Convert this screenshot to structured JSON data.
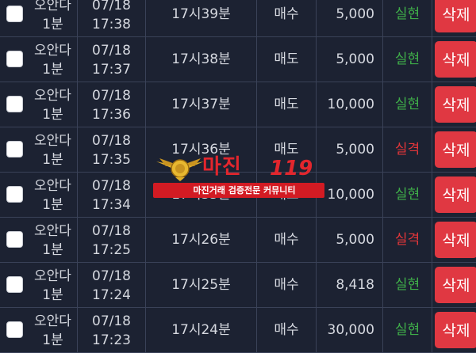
{
  "rows": [
    {
      "game_line1": "오안다",
      "game_line2": "1분",
      "date": "07/18",
      "time": "17:38",
      "round": "17시39분",
      "pick": "매수",
      "amount": "5,000",
      "result": "실현",
      "result_type": "win",
      "delete_label": "삭제"
    },
    {
      "game_line1": "오안다",
      "game_line2": "1분",
      "date": "07/18",
      "time": "17:37",
      "round": "17시38분",
      "pick": "매도",
      "amount": "5,000",
      "result": "실현",
      "result_type": "win",
      "delete_label": "삭제"
    },
    {
      "game_line1": "오안다",
      "game_line2": "1분",
      "date": "07/18",
      "time": "17:36",
      "round": "17시37분",
      "pick": "매도",
      "amount": "10,000",
      "result": "실현",
      "result_type": "win",
      "delete_label": "삭제"
    },
    {
      "game_line1": "오안다",
      "game_line2": "1분",
      "date": "07/18",
      "time": "17:35",
      "round": "17시36분",
      "pick": "매도",
      "amount": "5,000",
      "result": "실격",
      "result_type": "lose",
      "delete_label": "삭제"
    },
    {
      "game_line1": "오안다",
      "game_line2": "1분",
      "date": "07/18",
      "time": "17:34",
      "round": "17시35분",
      "pick": "매도",
      "amount": "10,000",
      "result": "실현",
      "result_type": "win",
      "delete_label": "삭제"
    },
    {
      "game_line1": "오안다",
      "game_line2": "1분",
      "date": "07/18",
      "time": "17:25",
      "round": "17시26분",
      "pick": "매수",
      "amount": "5,000",
      "result": "실격",
      "result_type": "lose",
      "delete_label": "삭제"
    },
    {
      "game_line1": "오안다",
      "game_line2": "1분",
      "date": "07/18",
      "time": "17:24",
      "round": "17시25분",
      "pick": "매수",
      "amount": "8,418",
      "result": "실현",
      "result_type": "win",
      "delete_label": "삭제"
    },
    {
      "game_line1": "오안다",
      "game_line2": "1분",
      "date": "07/18",
      "time": "17:23",
      "round": "17시24분",
      "pick": "매수",
      "amount": "30,000",
      "result": "실현",
      "result_type": "win",
      "delete_label": "삭제"
    }
  ],
  "watermark": {
    "title": "마진",
    "number": "119",
    "subtitle": "마진거래 검증전문 커뮤니티",
    "icon": "eagle-emblem-icon"
  },
  "colors": {
    "background": "#1c2232",
    "win": "#3fae49",
    "lose": "#e2363a",
    "delete_button": "#e03842"
  }
}
